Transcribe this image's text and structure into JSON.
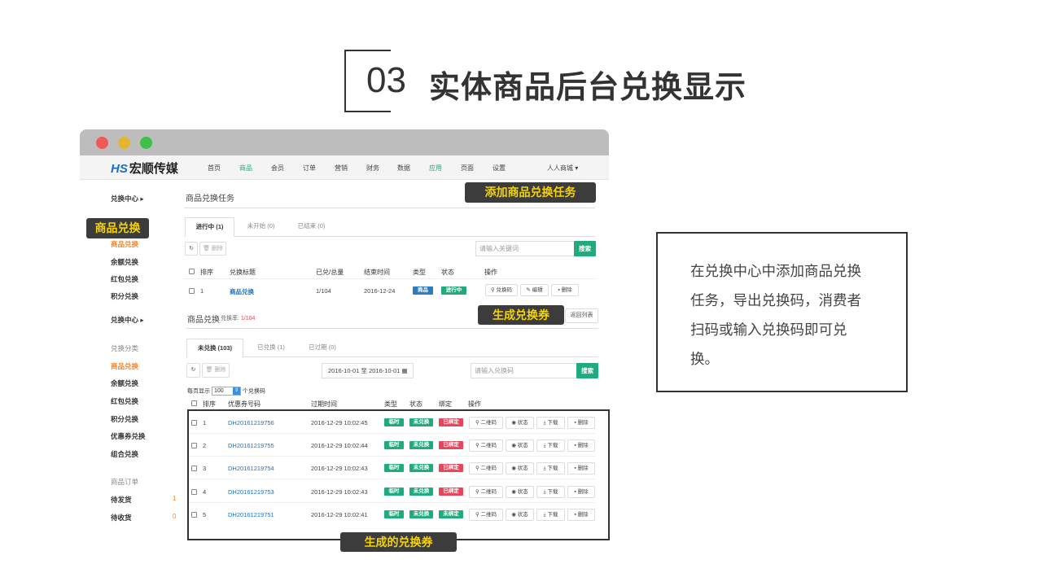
{
  "slide": {
    "number": "03",
    "title": "实体商品后台兑换显示"
  },
  "nav": {
    "logo_mark": "HS",
    "logo_text": "宏顺传媒",
    "items": [
      "首页",
      "商品",
      "会员",
      "订单",
      "营销",
      "财务",
      "数据",
      "应用",
      "页面",
      "设置"
    ],
    "store": "人人商城"
  },
  "sidebar": {
    "group1": "兑换中心",
    "group1_items": [
      "商品兑换",
      "余额兑换",
      "红包兑换",
      "积分兑换"
    ],
    "group2": "兑换中心",
    "group3": "兑换分类",
    "group3_items": [
      "商品兑换",
      "余额兑换",
      "红包兑换",
      "积分兑换",
      "优惠券兑换",
      "组合兑换"
    ],
    "group4": "商品订单",
    "group4_items": [
      {
        "label": "待发货",
        "count": "1"
      },
      {
        "label": "待收货",
        "count": "0"
      }
    ]
  },
  "task_section": {
    "title": "商品兑换任务",
    "tabs": [
      "进行中 (1)",
      "未开始 (0)",
      "已结束 (0)"
    ],
    "delete_btn": "删除",
    "search_placeholder": "请输入关键词",
    "search_btn": "搜索",
    "headers": [
      "排序",
      "兑换标题",
      "已兑/总量",
      "结束时间",
      "类型",
      "状态",
      "操作"
    ],
    "row": {
      "order": "1",
      "title": "商品兑换",
      "ratio": "1/104",
      "end": "2016-12-24",
      "type": "商品",
      "status": "进行中",
      "ops": [
        "兑换码",
        "编辑",
        "删除"
      ]
    }
  },
  "code_section": {
    "title": "商品兑换",
    "rate_label": "兑换率:",
    "rate_value": "1/104",
    "back_btn": "返回列表",
    "tabs": [
      "未兑换 (103)",
      "已兑换 (1)",
      "已过期 (0)"
    ],
    "delete_btn": "删除",
    "date_range": {
      "start": "2016-10-01",
      "sep": "至",
      "end": "2016-10-01"
    },
    "search_placeholder": "请输入兑换码",
    "search_btn": "搜索",
    "per_page_label": "每页显示",
    "per_page_value": "100",
    "per_page_suffix": "个兑换码",
    "headers": [
      "排序",
      "优惠券号码",
      "过期时间",
      "类型",
      "状态",
      "绑定",
      "操作"
    ],
    "ops": [
      "二维码",
      "状态",
      "下载",
      "删除"
    ],
    "rows": [
      {
        "order": "1",
        "code": "DH20161219756",
        "expire": "2016-12-29 10:02:45",
        "type": "临时",
        "status": "未兑换",
        "bind": "已绑定"
      },
      {
        "order": "2",
        "code": "DH20161219755",
        "expire": "2016-12-29 10:02:44",
        "type": "临时",
        "status": "未兑换",
        "bind": "已绑定"
      },
      {
        "order": "3",
        "code": "DH20161219754",
        "expire": "2016-12-29 10:02:43",
        "type": "临时",
        "status": "未兑换",
        "bind": "已绑定"
      },
      {
        "order": "4",
        "code": "DH20161219753",
        "expire": "2016-12-29 10:02:43",
        "type": "临时",
        "status": "未兑换",
        "bind": "已绑定"
      },
      {
        "order": "5",
        "code": "DH20161219751",
        "expire": "2016-12-29 10:02:41",
        "type": "临时",
        "status": "未兑换",
        "bind": "未绑定"
      }
    ]
  },
  "callouts": {
    "add_task": "添加商品兑换任务",
    "goods_exchange": "商品兑换",
    "generate_coupon": "生成兑换券",
    "generated_coupons": "生成的兑换券"
  },
  "description": "在兑换中心中添加商品兑换任务，导出兑换码，消费者扫码或输入兑换码即可兑换。",
  "colors": {
    "accent_green": "#1fab7e",
    "accent_blue": "#2b7cc3",
    "accent_red": "#e8445a",
    "callout_bg": "#3c3c3c",
    "callout_text": "#f5d300",
    "orange": "#f0862c"
  }
}
